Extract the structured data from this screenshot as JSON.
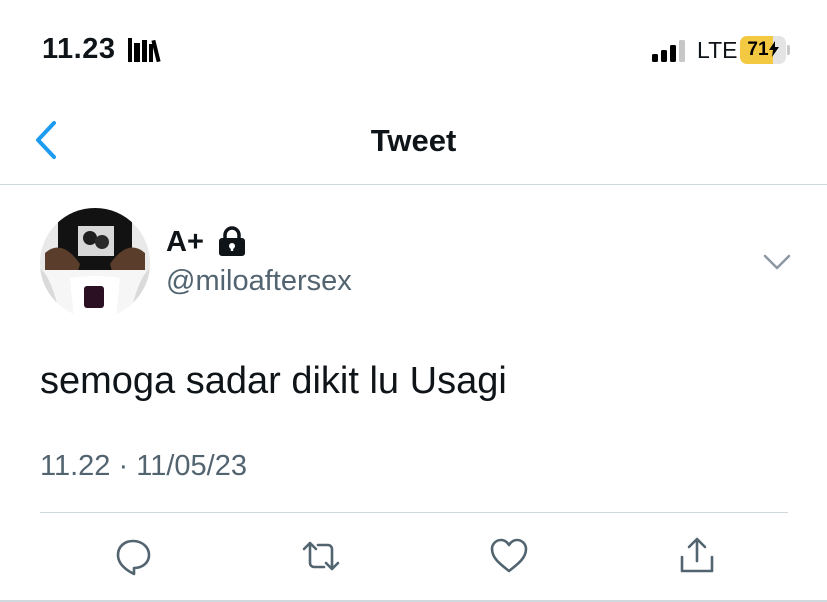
{
  "status_bar": {
    "time": "11.23",
    "network": "LTE",
    "battery_percent": "71",
    "battery_level": 0.71,
    "icons": [
      "library-icon",
      "signal-icon",
      "battery-charging-icon"
    ]
  },
  "nav": {
    "title": "Tweet",
    "back_icon": "chevron-left-icon"
  },
  "tweet": {
    "display_name": "A+",
    "protected_icon": "lock-icon",
    "handle": "@miloaftersex",
    "text": "semoga sadar dikit lu Usagi",
    "time": "11.22",
    "separator": "·",
    "date": "11/05/23",
    "more_icon": "chevron-down-icon"
  },
  "actions": {
    "reply_icon": "reply-icon",
    "retweet_icon": "retweet-icon",
    "like_icon": "heart-icon",
    "share_icon": "share-icon"
  },
  "colors": {
    "accent": "#1d9bf0",
    "text_primary": "#0f1419",
    "text_secondary": "#536471",
    "divider": "#cfd9de",
    "battery_fill": "#f4c942"
  }
}
